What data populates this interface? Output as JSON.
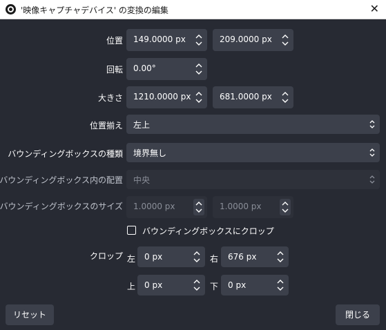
{
  "window": {
    "title": "'映像キャプチャデバイス' の変換の編集",
    "close_glyph": "✕"
  },
  "position": {
    "label": "位置",
    "x": "149.0000 px",
    "y": "209.0000 px"
  },
  "rotation": {
    "label": "回転",
    "value": "0.00°"
  },
  "size": {
    "label": "大きさ",
    "width": "1210.0000 px",
    "height": "681.0000 px"
  },
  "alignment": {
    "label": "位置揃え",
    "value": "左上"
  },
  "bounding_box_type": {
    "label": "バウンディングボックスの種類",
    "value": "境界無し"
  },
  "bounding_box_alignment": {
    "label": "バウンディングボックス内の配置",
    "value": "中央"
  },
  "bounding_box_size": {
    "label": "バウンディングボックスのサイズ",
    "width": "1.0000 px",
    "height": "1.0000 px"
  },
  "crop_to_bounds": {
    "label": "バウンディングボックスにクロップ",
    "checked": false
  },
  "crop": {
    "label": "クロップ",
    "left_label": "左",
    "left": "0 px",
    "right_label": "右",
    "right": "676 px",
    "top_label": "上",
    "top": "0 px",
    "bottom_label": "下",
    "bottom": "0 px"
  },
  "buttons": {
    "reset": "リセット",
    "close": "閉じる"
  },
  "colors": {
    "background": "#272a33",
    "field": "#3c404b",
    "title_bar": "#ffffff"
  }
}
